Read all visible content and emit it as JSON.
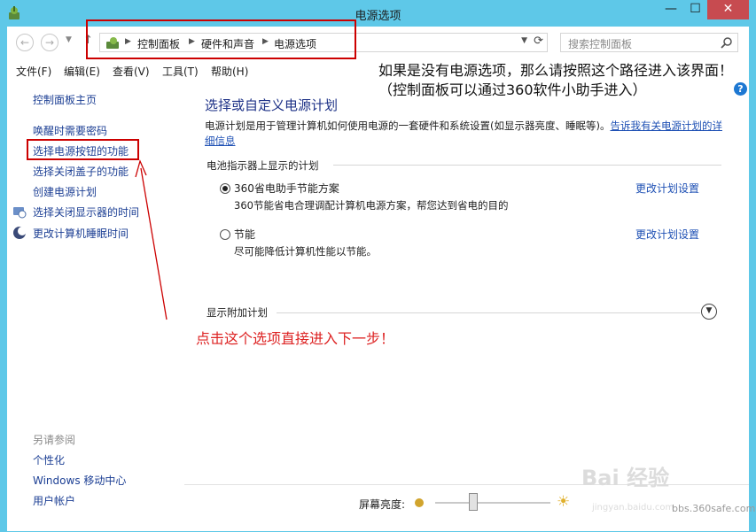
{
  "window": {
    "title": "电源选项",
    "minimize": "—",
    "maximize": "☐",
    "close": "✕",
    "background_color": "#5ec8e8"
  },
  "address_bar": {
    "breadcrumbs": [
      "控制面板",
      "硬件和声音",
      "电源选项"
    ],
    "search_placeholder": "搜索控制面板"
  },
  "menu": [
    "文件(F)",
    "编辑(E)",
    "查看(V)",
    "工具(T)",
    "帮助(H)"
  ],
  "sidebar": {
    "home": "控制面板主页",
    "links": [
      "唤醒时需要密码",
      "选择电源按钮的功能",
      "选择关闭盖子的功能",
      "创建电源计划",
      "选择关闭显示器的时间",
      "更改计算机睡眠时间"
    ],
    "see_also_title": "另请参阅",
    "see_also": [
      "个性化",
      "Windows 移动中心",
      "用户帐户"
    ]
  },
  "main": {
    "heading": "选择或自定义电源计划",
    "description": "电源计划是用于管理计算机如何使用电源的一套硬件和系统设置(如显示器亮度、睡眠等)。",
    "description_link": "告诉我有关电源计划的详细信息",
    "battery_section": "电池指示器上显示的计划",
    "plans": [
      {
        "name": "360省电助手节能方案",
        "desc": "360节能省电合理调配计算机电源方案，帮您达到省电的目的",
        "link": "更改计划设置",
        "selected": true
      },
      {
        "name": "节能",
        "desc": "尽可能降低计算机性能以节能。",
        "link": "更改计划设置",
        "selected": false
      }
    ],
    "extra_section": "显示附加计划"
  },
  "bottom": {
    "brightness_label": "屏幕亮度:",
    "brightness_level": 0.33
  },
  "annotations": {
    "top_note": "如果是没有电源选项，那么请按照这个路径进入该界面！（控制面板可以通过360软件小助手进入）",
    "side_note": "点击这个选项直接进入下一步！",
    "accent_color": "#cc0000"
  },
  "watermark": {
    "text": "Bai 经验",
    "sub": "jingyan.baidu.com",
    "corner": "bbs.360safe.com"
  }
}
